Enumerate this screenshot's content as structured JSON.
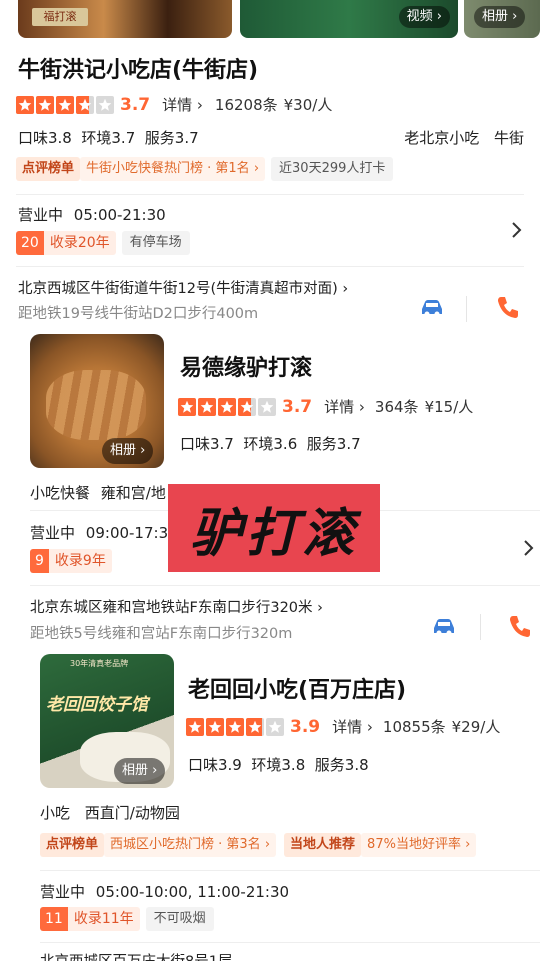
{
  "colors": {
    "accent": "#ff6633",
    "car": "#3d7fd9",
    "phone": "#ff6633"
  },
  "top_strip": {
    "video_label": "视频",
    "album_label": "相册",
    "sign_text": "福打滚"
  },
  "shop1": {
    "name": "牛街洪记小吃店(牛街店)",
    "rating": "3.7",
    "rating_value": 3.7,
    "detail": "详情",
    "reviews": "16208条",
    "price": "¥30/人",
    "scores": "口味3.8  环境3.7  服务3.7",
    "category": "老北京小吃",
    "area": "牛街",
    "rank_label": "点评榜单",
    "rank_text": "牛街小吃快餐热门榜 · 第1名",
    "checkin": "近30天299人打卡",
    "status": "营业中",
    "hours": "05:00-21:30",
    "years_num": "20",
    "years_text": "收录20年",
    "facility": "有停车场",
    "address": "北京西城区牛街街道牛街12号(牛街清真超市对面)",
    "metro": "距地铁19号线牛街站D2口步行400m"
  },
  "shop2": {
    "name": "易德缘驴打滚",
    "rating": "3.7",
    "rating_value": 3.7,
    "detail": "详情",
    "reviews": "364条",
    "price": "¥15/人",
    "scores": "口味3.7  环境3.6  服务3.7",
    "album": "相册",
    "category": "小吃快餐",
    "area": "雍和宫/地",
    "status": "营业中",
    "hours": "09:00-17:3",
    "years_num": "9",
    "years_text": "收录9年",
    "address": "北京东城区雍和宫地铁站F东南口步行320米",
    "metro": "距地铁5号线雍和宫站F东南口步行320m"
  },
  "overlay_banner": {
    "text": "驴打滚"
  },
  "shop3": {
    "name": "老回回小吃(百万庄店)",
    "rating": "3.9",
    "rating_value": 3.9,
    "detail": "详情",
    "reviews": "10855条",
    "price": "¥29/人",
    "scores": "口味3.9  环境3.8  服务3.8",
    "album": "相册",
    "photo_sign": "老回回饺子馆",
    "photo_caption": "30年清真老品牌",
    "category": "小吃",
    "area": "西直门/动物园",
    "rank_label": "点评榜单",
    "rank_text": "西城区小吃热门榜 · 第3名",
    "local_label": "当地人推荐",
    "local_text": "87%当地好评率",
    "status": "营业中",
    "hours": "05:00-10:00, 11:00-21:30",
    "years_num": "11",
    "years_text": "收录11年",
    "facility": "不可吸烟",
    "address_partial": "北京西城区百万庄大街8号1层"
  }
}
